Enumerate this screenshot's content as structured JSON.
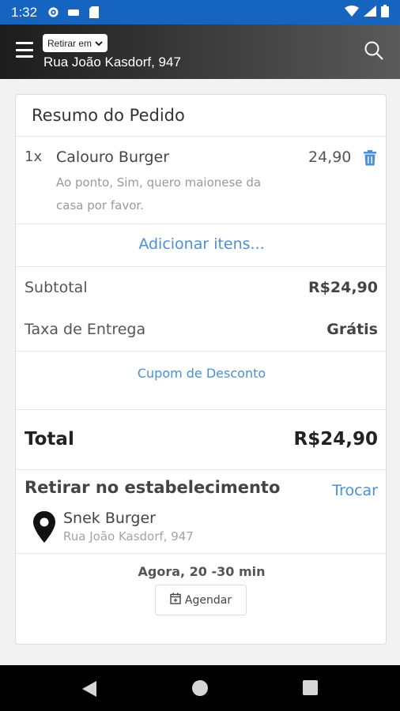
{
  "status_bar": {
    "time": "1:32",
    "icons": [
      "gear-icon",
      "sim-icon",
      "sd-card-icon",
      "wifi-icon",
      "signal-icon",
      "battery-icon"
    ]
  },
  "header": {
    "pickup_select": "Retirar em",
    "address": "Rua João Kasdorf, 947",
    "icons": [
      "menu-icon",
      "chevron-down-icon",
      "search-icon"
    ]
  },
  "order": {
    "title": "Resumo do Pedido",
    "items": [
      {
        "qty": "1x",
        "name": "Calouro Burger",
        "price": "24,90",
        "note": "Ao ponto, Sim, quero maionese da casa por favor."
      }
    ],
    "add_items": "Adicionar itens...",
    "subtotal_label": "Subtotal",
    "subtotal_value": "R$24,90",
    "delivery_label": "Taxa de Entrega",
    "delivery_value": "Grátis",
    "coupon": "Cupom de Desconto",
    "total_label": "Total",
    "total_value": "R$24,90"
  },
  "pickup": {
    "title": "Retirar no estabelecimento",
    "change": "Trocar",
    "store_name": "Snek Burger",
    "store_address": "Rua João Kasdorf, 947",
    "eta": "Agora, 20 -30 min",
    "schedule": "Agendar"
  },
  "colors": {
    "status_bar": "#1565c0",
    "accent_link": "#4a90d9",
    "delete_icon": "#4a90d9"
  }
}
